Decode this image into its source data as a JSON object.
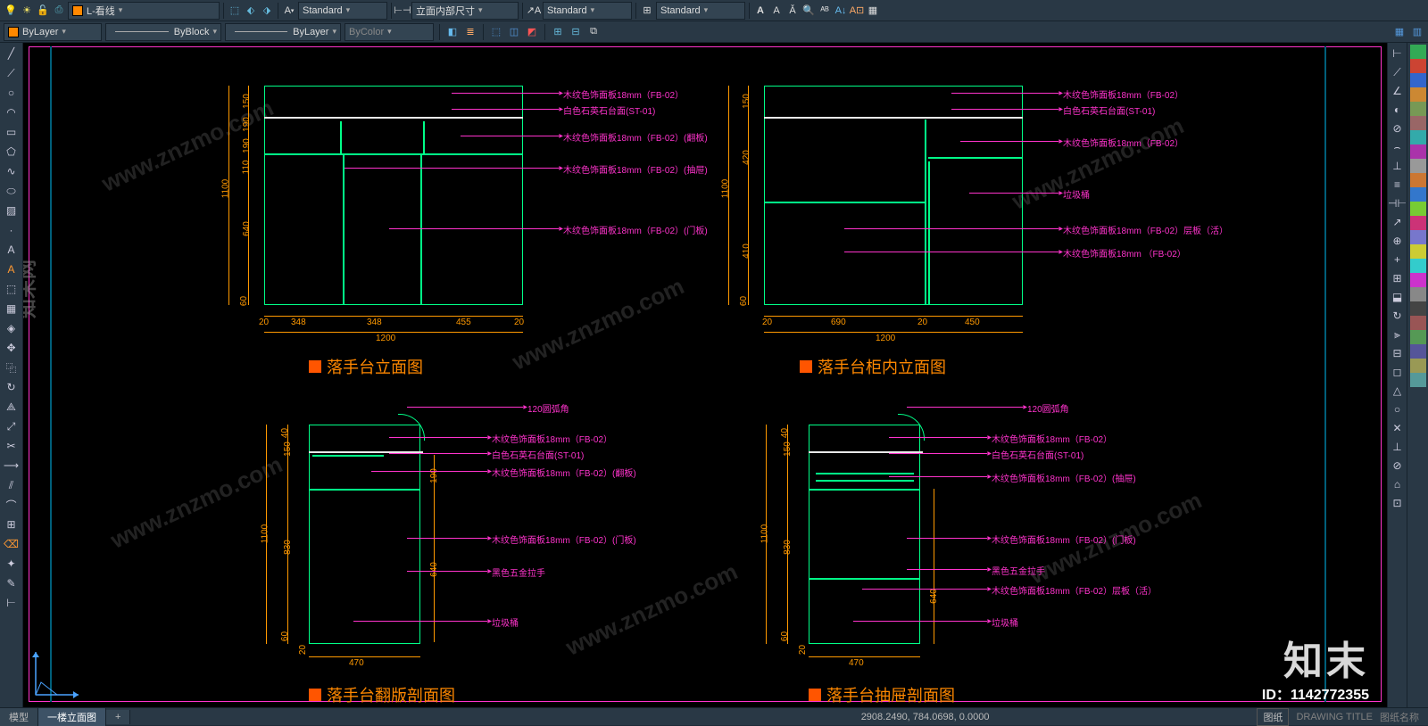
{
  "toolbar": {
    "layer_name": "L-看线",
    "style1": "Standard",
    "dim_style": "立面内部尺寸",
    "style2": "Standard",
    "style3": "Standard",
    "color_combo": "ByLayer",
    "ltype_combo": "ByBlock",
    "lwt_combo": "ByLayer",
    "plot_combo": "ByColor"
  },
  "status": {
    "tab_model": "模型",
    "tab_layout": "一楼立面图",
    "coords": "2908.2490, 784.0698, 0.0000",
    "paper": "图纸",
    "draw_title": "DRAWING TITLE",
    "proj": "图纸名称"
  },
  "drawing": {
    "t1": "落手台立面图",
    "t2": "落手台柜内立面图",
    "t3": "落手台翻版剖面图",
    "t4": "落手台抽屉剖面图",
    "notes": {
      "n1": "木纹色饰面板18mm（FB-02）",
      "n2": "白色石英石台面(ST-01)",
      "n3": "木纹色饰面板18mm（FB-02）(翻板)",
      "n4": "木纹色饰面板18mm（FB-02）(抽屉)",
      "n5": "木纹色饰面板18mm（FB-02）(门板)",
      "n6": "垃圾桶",
      "n7": "木纹色饰面板18mm（FB-02）层板（活）",
      "n8": "木纹色饰面板18mm （FB-02）",
      "n9": "120圆弧角",
      "n10": "黑色五金拉手",
      "n11": "木纹色饰面板18mm（FB-02）层板（活）"
    },
    "dims": {
      "d1100": "1100",
      "d1200": "1200",
      "d150": "150",
      "d190_1": "190",
      "d190_2": "190",
      "d110": "110",
      "d640": "640",
      "d60": "60",
      "d20": "20",
      "d348": "348",
      "d455": "455",
      "d420": "420",
      "d410": "410",
      "d690": "690",
      "d450": "450",
      "d40": "40",
      "d830": "830",
      "d470": "470"
    }
  },
  "watermark": {
    "logo": "知末",
    "id": "ID：1142772355",
    "url": "www.znzmo.com",
    "side": "知末网"
  }
}
